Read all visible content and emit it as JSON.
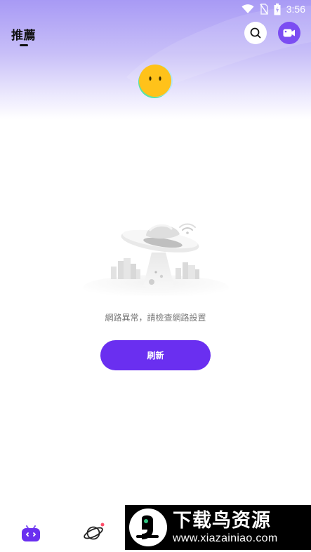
{
  "status_bar": {
    "time": "3:56",
    "icons": [
      "wifi-icon",
      "no-sim-icon",
      "battery-icon"
    ]
  },
  "header": {
    "title": "推薦",
    "icons": [
      "search-icon",
      "video-camera-icon"
    ]
  },
  "error_state": {
    "illustration": "ufo-illustration",
    "message": "網路異常，請檢查網路設置",
    "refresh_label": "刷新"
  },
  "tabbar": {
    "items": [
      {
        "icon": "home-tv-icon",
        "active": true
      },
      {
        "icon": "planet-icon",
        "badge_dot": true
      }
    ]
  },
  "watermark": {
    "title": "下载鸟资源",
    "url": "www.xiazainiao.com"
  },
  "colors": {
    "accent": "#6a2ff0",
    "header_gradient_top": "#a89af5",
    "mascot_yellow": "#ffc21a"
  }
}
